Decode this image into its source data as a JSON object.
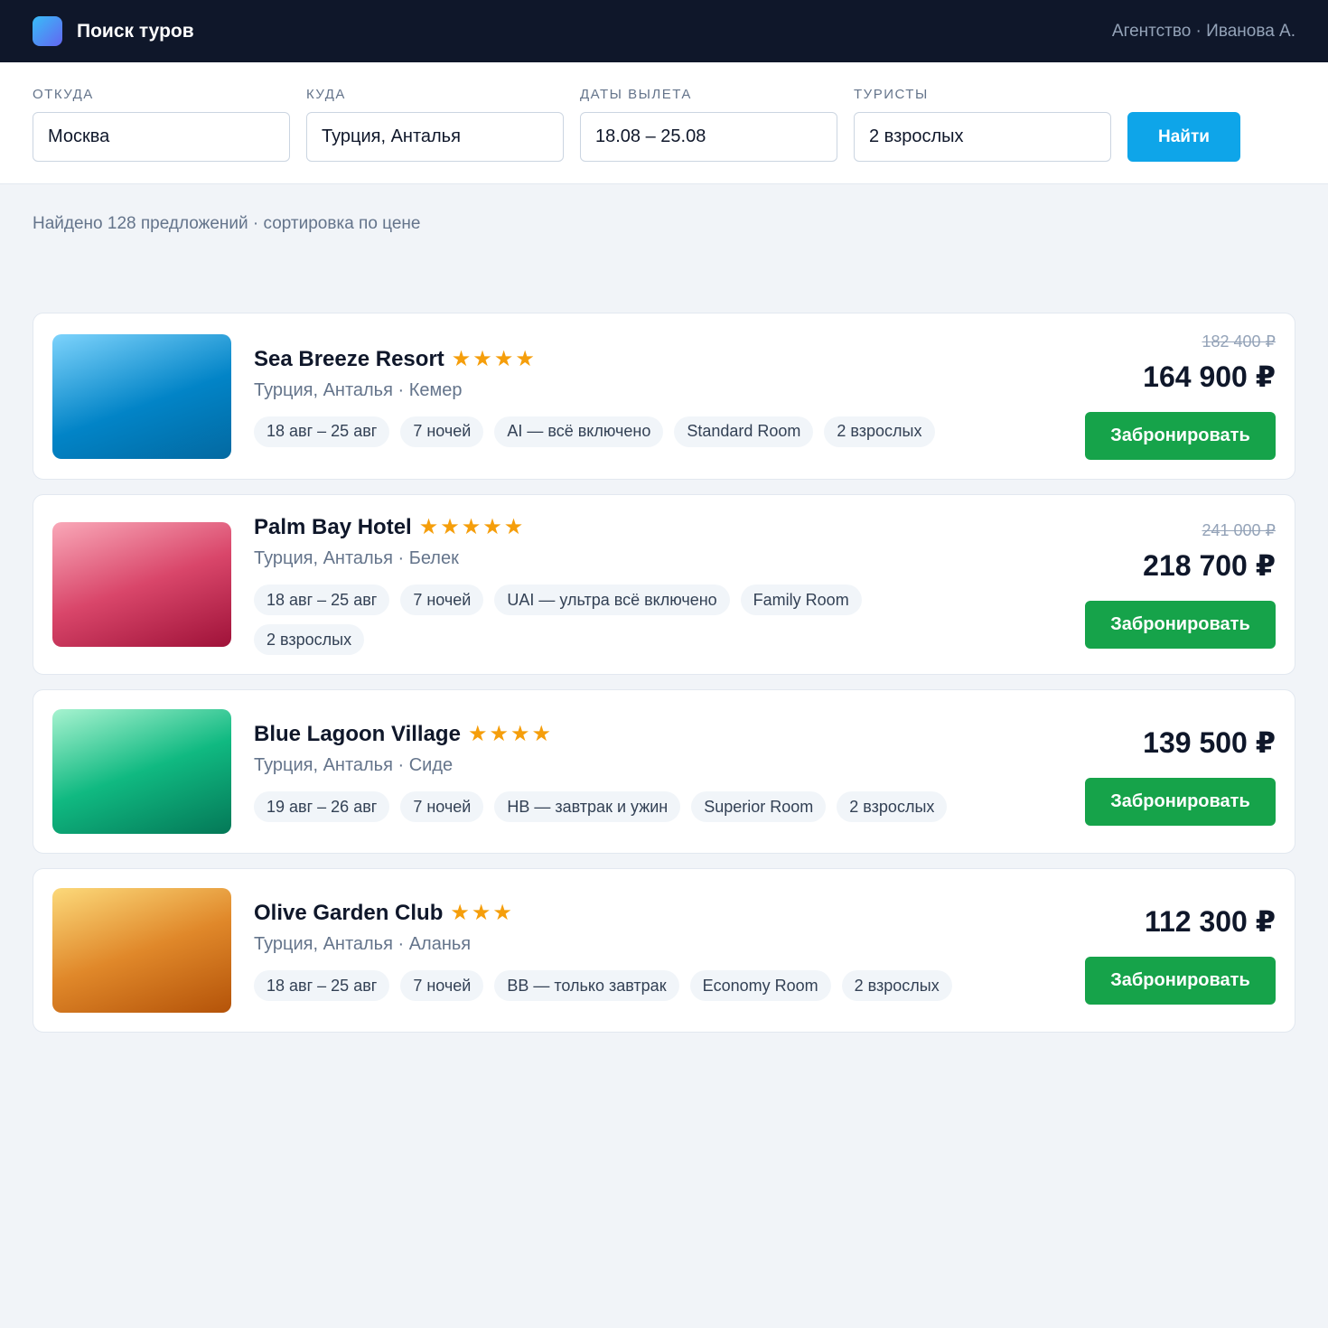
{
  "header": {
    "app_title": "Поиск туров",
    "agent": "Агентство · Иванова А."
  },
  "search": {
    "from": {
      "label": "ОТКУДА",
      "value": "Москва"
    },
    "to": {
      "label": "КУДА",
      "value": "Турция, Анталья"
    },
    "dates": {
      "label": "ДАТЫ ВЫЛЕТА",
      "value": "18.08 – 25.08"
    },
    "tourists": {
      "label": "ТУРИСТЫ",
      "value": "2 взрослых"
    },
    "find_label": "Найти"
  },
  "results": {
    "summary": "Найдено 128 предложений · сортировка по цене"
  },
  "colors": {
    "accent": "#0ea5e9",
    "book": "#16a34a",
    "star": "#f59e0b",
    "topbar": "#0f172a"
  },
  "offers": [
    {
      "name": "Sea Breeze Resort",
      "stars": 4,
      "location": "Турция, Анталья · Кемер",
      "tags": [
        "18 авг – 25 авг",
        "7 ночей",
        "AI — всё включено",
        "Standard Room",
        "2 взрослых"
      ],
      "old_price": "182 400 ₽",
      "price": "164 900 ₽",
      "book_label": "Забронировать"
    },
    {
      "name": "Palm Bay Hotel",
      "stars": 5,
      "location": "Турция, Анталья · Белек",
      "tags": [
        "18 авг – 25 авг",
        "7 ночей",
        "UAI — ультра всё включено",
        "Family Room",
        "2 взрослых"
      ],
      "old_price": "241 000 ₽",
      "price": "218 700 ₽",
      "book_label": "Забронировать"
    },
    {
      "name": "Blue Lagoon Village",
      "stars": 4,
      "location": "Турция, Анталья · Сиде",
      "tags": [
        "19 авг – 26 авг",
        "7 ночей",
        "HB — завтрак и ужин",
        "Superior Room",
        "2 взрослых"
      ],
      "old_price": "",
      "price": "139 500 ₽",
      "book_label": "Забронировать"
    },
    {
      "name": "Olive Garden Club",
      "stars": 3,
      "location": "Турция, Анталья · Аланья",
      "tags": [
        "18 авг – 25 авг",
        "7 ночей",
        "BB — только завтрак",
        "Economy Room",
        "2 взрослых"
      ],
      "old_price": "",
      "price": "112 300 ₽",
      "book_label": "Забронировать"
    }
  ]
}
